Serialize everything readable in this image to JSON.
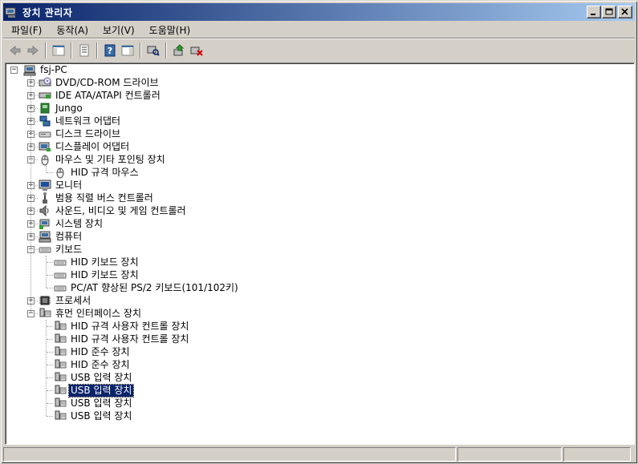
{
  "window": {
    "title": "장치 관리자"
  },
  "menu": [
    {
      "label": "파일(F)"
    },
    {
      "label": "동작(A)"
    },
    {
      "label": "보기(V)"
    },
    {
      "label": "도움말(H)"
    }
  ],
  "tree": {
    "root": "fsj-PC",
    "nodes": [
      {
        "label": "DVD/CD-ROM 드라이브",
        "level": 1,
        "expander": "+",
        "icon": "dvd-drive-icon"
      },
      {
        "label": "IDE ATA/ATAPI 컨트롤러",
        "level": 1,
        "expander": "+",
        "icon": "ide-controller-icon"
      },
      {
        "label": "Jungo",
        "level": 1,
        "expander": "+",
        "icon": "jungo-device-icon"
      },
      {
        "label": "네트워크 어댑터",
        "level": 1,
        "expander": "+",
        "icon": "network-adapter-icon"
      },
      {
        "label": "디스크 드라이브",
        "level": 1,
        "expander": "+",
        "icon": "disk-drive-icon"
      },
      {
        "label": "디스플레이 어댑터",
        "level": 1,
        "expander": "+",
        "icon": "display-adapter-icon"
      },
      {
        "label": "마우스 및 기타 포인팅 장치",
        "level": 1,
        "expander": "-",
        "icon": "mouse-icon"
      },
      {
        "label": "HID 규격 마우스",
        "level": 2,
        "icon": "mouse-icon"
      },
      {
        "label": "모니터",
        "level": 1,
        "expander": "+",
        "icon": "monitor-icon"
      },
      {
        "label": "범용 직렬 버스 컨트롤러",
        "level": 1,
        "expander": "+",
        "icon": "usb-controller-icon"
      },
      {
        "label": "사운드, 비디오 및 게임 컨트롤러",
        "level": 1,
        "expander": "+",
        "icon": "sound-icon"
      },
      {
        "label": "시스템 장치",
        "level": 1,
        "expander": "+",
        "icon": "system-device-icon"
      },
      {
        "label": "컴퓨터",
        "level": 1,
        "expander": "+",
        "icon": "computer-icon"
      },
      {
        "label": "키보드",
        "level": 1,
        "expander": "-",
        "icon": "keyboard-icon"
      },
      {
        "label": "HID 키보드 장치",
        "level": 2,
        "icon": "keyboard-icon"
      },
      {
        "label": "HID 키보드 장치",
        "level": 2,
        "icon": "keyboard-icon"
      },
      {
        "label": "PC/AT 향상된 PS/2 키보드(101/102키)",
        "level": 2,
        "icon": "keyboard-icon"
      },
      {
        "label": "프로세서",
        "level": 1,
        "expander": "+",
        "icon": "processor-icon"
      },
      {
        "label": "휴먼 인터페이스 장치",
        "level": 1,
        "expander": "-",
        "icon": "hid-icon"
      },
      {
        "label": "HID 규격 사용자 컨트롤 장치",
        "level": 2,
        "icon": "hid-icon"
      },
      {
        "label": "HID 규격 사용자 컨트롤 장치",
        "level": 2,
        "icon": "hid-icon"
      },
      {
        "label": "HID 준수 장치",
        "level": 2,
        "icon": "hid-icon"
      },
      {
        "label": "HID 준수 장치",
        "level": 2,
        "icon": "hid-icon"
      },
      {
        "label": "USB 입력 장치",
        "level": 2,
        "icon": "hid-icon"
      },
      {
        "label": "USB 입력 장치",
        "level": 2,
        "icon": "hid-icon",
        "selected": true
      },
      {
        "label": "USB 입력 장치",
        "level": 2,
        "icon": "hid-icon"
      },
      {
        "label": "USB 입력 장치",
        "level": 2,
        "icon": "hid-icon"
      }
    ]
  },
  "colors": {
    "title_start": "#0a246a",
    "title_end": "#a6caf0",
    "selection": "#0a246a",
    "chrome": "#d4d0c8"
  }
}
